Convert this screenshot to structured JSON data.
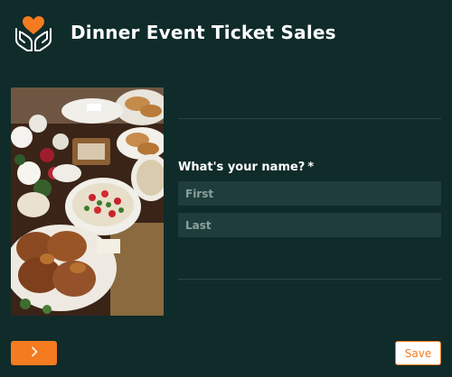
{
  "header": {
    "title": "Dinner Event Ticket Sales",
    "logo_icon": "heart-hands-icon",
    "logo_colors": {
      "heart": "#f47b20",
      "hands": "#ffffff"
    }
  },
  "hero_image": {
    "icon": "dinner-buffet-photo"
  },
  "form": {
    "name_label": "What's your name?",
    "required_mark": "*",
    "first_placeholder": "First",
    "first_value": "",
    "last_placeholder": "Last",
    "last_value": ""
  },
  "footer": {
    "next_icon": "chevron-right-icon",
    "save_label": "Save"
  },
  "colors": {
    "background": "#0f2b2a",
    "input_bg": "#1e3d3b",
    "accent": "#f47b20"
  }
}
